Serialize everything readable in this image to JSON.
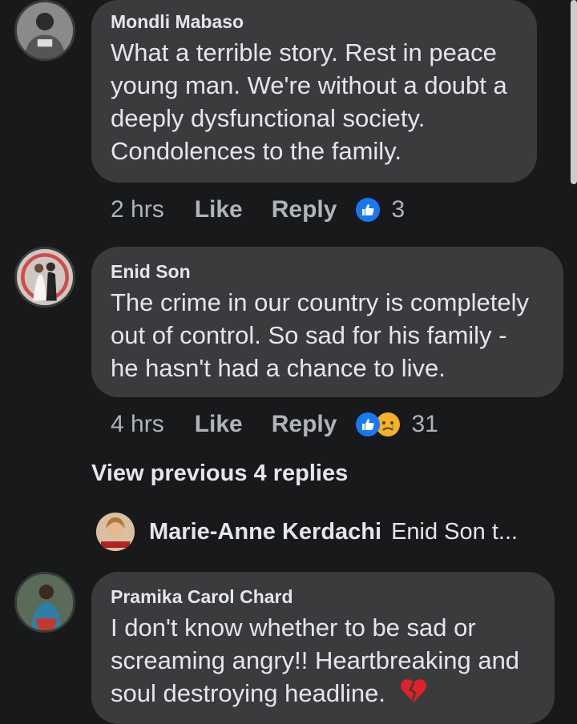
{
  "comments": [
    {
      "author": "Mondli Mabaso",
      "lines": [
        "What a terrible story. Rest in peace",
        "young man. We're without a doubt a",
        "deeply dysfunctional society.",
        "Condolences to the family."
      ],
      "time": "2 hrs",
      "like_label": "Like",
      "reply_label": "Reply",
      "reaction_count": "3"
    },
    {
      "author": "Enid Son",
      "lines": [
        "The crime in our country is completely",
        "out of control. So sad for his family -",
        "he hasn't had a chance to live."
      ],
      "time": "4 hrs",
      "like_label": "Like",
      "reply_label": "Reply",
      "reaction_count": "31"
    },
    {
      "author": "Pramika Carol Chard",
      "lines": [
        "I don't know whether to be sad or",
        "screaming angry!!  Heartbreaking and",
        "soul destroying headline."
      ]
    }
  ],
  "view_previous_replies": "View previous 4 replies",
  "reply_preview": {
    "author": "Marie-Anne Kerdachi",
    "snippet": "Enid Son t..."
  },
  "icons": {
    "like_reaction": "thumbs-up-icon",
    "sad_reaction": "sad-face-icon",
    "broken_heart": "broken-heart-icon"
  },
  "colors": {
    "background": "#18191a",
    "bubble": "#3a3b3c",
    "like_blue": "#1877f2",
    "secondary_text": "#b0b3b8"
  }
}
